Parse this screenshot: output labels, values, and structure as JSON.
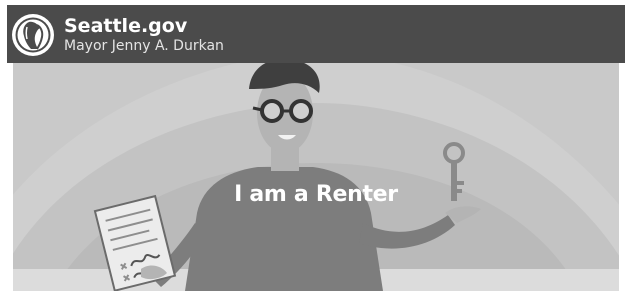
{
  "header": {
    "site_name": "Seattle.gov",
    "subtitle": "Mayor Jenny A. Durkan",
    "logo_icon": "seattle-seal-icon"
  },
  "hero": {
    "title": "I am a Renter",
    "illustration": "renter-person-holding-lease-and-key"
  },
  "colors": {
    "header_bg": "#4b4b4b",
    "header_text": "#ffffff",
    "hero_bg": "#c9c9c9",
    "hero_title": "#ffffff"
  }
}
